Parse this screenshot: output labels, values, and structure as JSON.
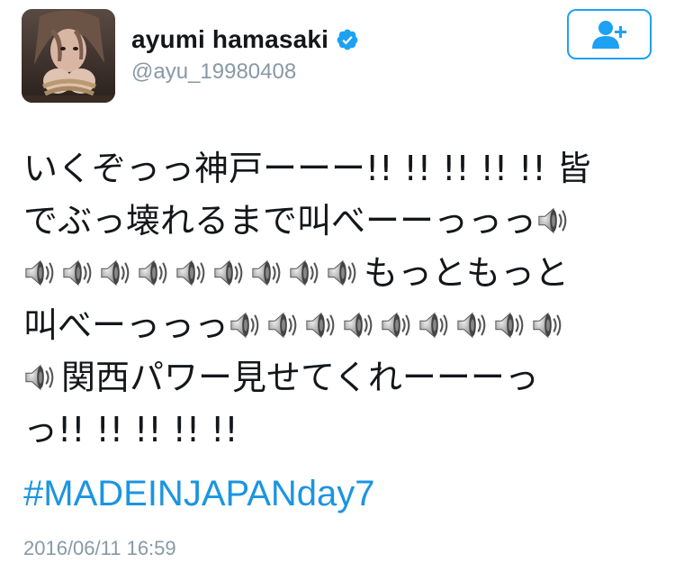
{
  "user": {
    "display_name": "ayumi hamasaki",
    "handle": "@ayu_19980408",
    "verified": true,
    "avatar_icon": "avatar-photo"
  },
  "follow_button": {
    "icon": "add-user-icon",
    "color": "#1da1f2"
  },
  "tweet": {
    "lines": [
      [
        {
          "t": "text",
          "v": "いくぞっっ神戸ーーー!! !! !! !! !! 皆"
        }
      ],
      [
        {
          "t": "text",
          "v": "でぶっ壊れるまで叫べーーっっっ"
        },
        {
          "t": "icon"
        }
      ],
      [
        {
          "t": "icon"
        },
        {
          "t": "icon"
        },
        {
          "t": "icon"
        },
        {
          "t": "icon"
        },
        {
          "t": "icon"
        },
        {
          "t": "icon"
        },
        {
          "t": "icon"
        },
        {
          "t": "icon"
        },
        {
          "t": "icon"
        },
        {
          "t": "text",
          "v": "もっともっと"
        }
      ],
      [
        {
          "t": "text",
          "v": "叫べーっっっ"
        },
        {
          "t": "icon"
        },
        {
          "t": "icon"
        },
        {
          "t": "icon"
        },
        {
          "t": "icon"
        },
        {
          "t": "icon"
        },
        {
          "t": "icon"
        },
        {
          "t": "icon"
        },
        {
          "t": "icon"
        },
        {
          "t": "icon"
        }
      ],
      [
        {
          "t": "icon"
        },
        {
          "t": "text",
          "v": "関西パワー見せてくれーーーっ"
        }
      ],
      [
        {
          "t": "text",
          "v": "っ!! !! !! !! !!"
        }
      ]
    ],
    "emoji_icon": "speaker-loud-icon",
    "hashtag": "#MADEINJAPANday7",
    "timestamp": "2016/06/11 16:59"
  },
  "colors": {
    "link": "#1b95e0",
    "muted": "#8899a6",
    "text": "#14171a"
  }
}
